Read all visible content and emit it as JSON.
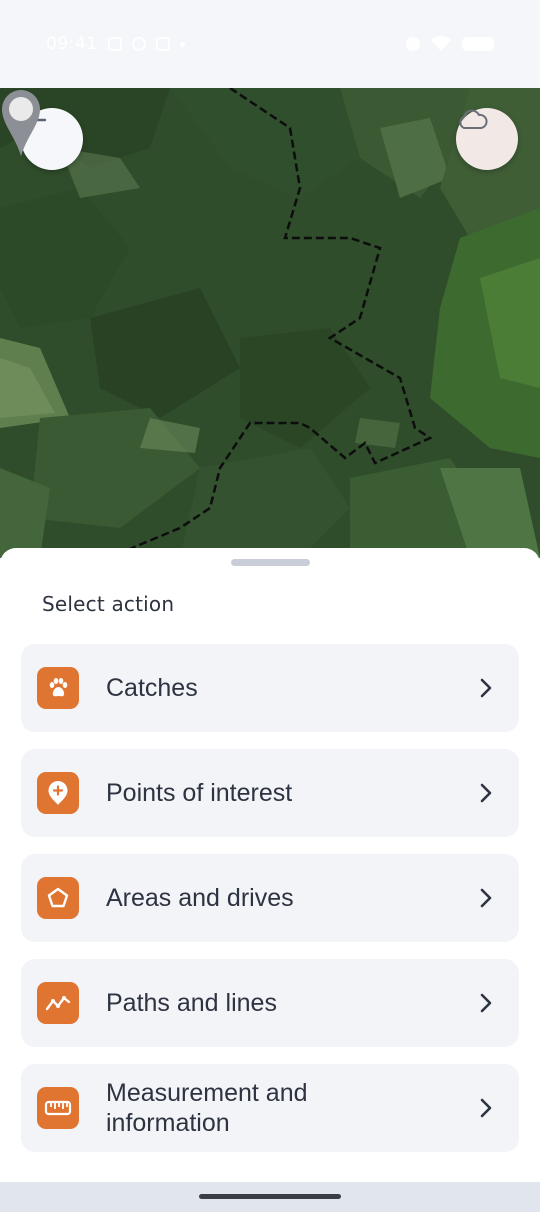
{
  "status_bar": {
    "time": "09:41"
  },
  "map": {
    "back_icon": "arrow-left-icon",
    "cloud_icon": "cloud-icon",
    "pin_icon": "map-pin-icon"
  },
  "sheet": {
    "title": "Select action",
    "actions": [
      {
        "label": "Catches",
        "icon": "paw-icon"
      },
      {
        "label": "Points of interest",
        "icon": "location-plus-icon"
      },
      {
        "label": "Areas and drives",
        "icon": "pentagon-icon"
      },
      {
        "label": "Paths and lines",
        "icon": "polyline-icon"
      },
      {
        "label": "Measurement and information",
        "icon": "ruler-icon"
      }
    ]
  },
  "colors": {
    "accent": "#e07531",
    "sheet_background": "#ffffff",
    "item_background": "#f3f4f8",
    "text": "#2d3340"
  }
}
